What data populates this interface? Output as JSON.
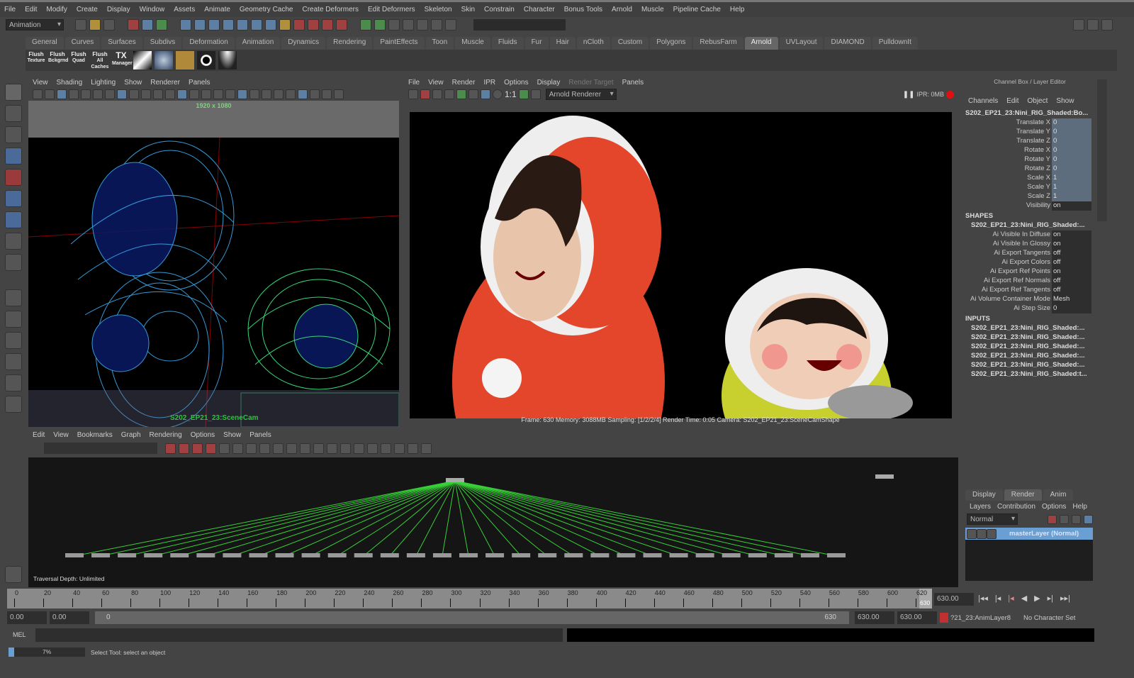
{
  "menubar": [
    "File",
    "Edit",
    "Modify",
    "Create",
    "Display",
    "Window",
    "Assets",
    "Animate",
    "Geometry Cache",
    "Create Deformers",
    "Edit Deformers",
    "Skeleton",
    "Skin",
    "Constrain",
    "Character",
    "Bonus Tools",
    "Arnold",
    "Muscle",
    "Pipeline Cache",
    "Help"
  ],
  "statusline": {
    "menuset": "Animation",
    "search_value": ""
  },
  "shelf_tabs": [
    "General",
    "Curves",
    "Surfaces",
    "Subdivs",
    "Deformation",
    "Animation",
    "Dynamics",
    "Rendering",
    "PaintEffects",
    "Toon",
    "Muscle",
    "Fluids",
    "Fur",
    "Hair",
    "nCloth",
    "Custom",
    "Polygons",
    "RebusFarm",
    "Arnold",
    "UVLayout",
    "DIAMOND",
    "PulldownIt"
  ],
  "active_shelf_tab": "Arnold",
  "shelf_buttons": [
    {
      "l1": "Flush",
      "l2": "Texture"
    },
    {
      "l1": "Flush",
      "l2": "Bckgrnd"
    },
    {
      "l1": "Flush",
      "l2": "Quad"
    },
    {
      "l1": "Flush",
      "l2": "All Caches"
    },
    {
      "l1": "TX",
      "l2": "Manager"
    }
  ],
  "viewport": {
    "menu": [
      "View",
      "Shading",
      "Lighting",
      "Show",
      "Renderer",
      "Panels"
    ],
    "resolution": "1920 x 1080",
    "camera": "S202_EP21_23:SceneCam"
  },
  "render_view": {
    "menu": [
      "File",
      "View",
      "Render",
      "IPR",
      "Options",
      "Display",
      "Render Target",
      "Panels"
    ],
    "ratio": "1:1",
    "renderer": "Arnold Renderer",
    "ipr": "IPR: 0MB",
    "status": "Frame: 630   Memory: 3088MB   Sampling: [1/2/2/4]   Render Time: 0:05   Camera: S202_EP21_23:SceneCamShape"
  },
  "channel_box": {
    "title": "Channel Box / Layer Editor",
    "menu": [
      "Channels",
      "Edit",
      "Object",
      "Show"
    ],
    "object": "S202_EP21_23:Nini_RIG_Shaded:Bo...",
    "channels": [
      {
        "name": "Translate X",
        "value": "0"
      },
      {
        "name": "Translate Y",
        "value": "0"
      },
      {
        "name": "Translate Z",
        "value": "0"
      },
      {
        "name": "Rotate X",
        "value": "0"
      },
      {
        "name": "Rotate Y",
        "value": "0"
      },
      {
        "name": "Rotate Z",
        "value": "0"
      },
      {
        "name": "Scale X",
        "value": "1"
      },
      {
        "name": "Scale Y",
        "value": "1"
      },
      {
        "name": "Scale Z",
        "value": "1"
      },
      {
        "name": "Visibility",
        "value": "on"
      }
    ],
    "shapes_header": "SHAPES",
    "shape_name": "S202_EP21_23:Nini_RIG_Shaded:...",
    "shape_attrs": [
      {
        "name": "Ai Visible In Diffuse",
        "value": "on"
      },
      {
        "name": "Ai Visible In Glossy",
        "value": "on"
      },
      {
        "name": "Ai Export Tangents",
        "value": "off"
      },
      {
        "name": "Ai Export Colors",
        "value": "off"
      },
      {
        "name": "Ai Export Ref Points",
        "value": "on"
      },
      {
        "name": "Ai Export Ref Normals",
        "value": "off"
      },
      {
        "name": "Ai Export Ref Tangents",
        "value": "off"
      },
      {
        "name": "Ai Volume Container Mode",
        "value": "Mesh"
      },
      {
        "name": "Ai Step Size",
        "value": "0"
      }
    ],
    "inputs_header": "INPUTS",
    "inputs": [
      "S202_EP21_23:Nini_RIG_Shaded:...",
      "S202_EP21_23:Nini_RIG_Shaded:...",
      "S202_EP21_23:Nini_RIG_Shaded:...",
      "S202_EP21_23:Nini_RIG_Shaded:...",
      "S202_EP21_23:Nini_RIG_Shaded:...",
      "S202_EP21_23:Nini_RIG_Shaded:t..."
    ]
  },
  "layer_editor": {
    "tabs": [
      "Display",
      "Render",
      "Anim"
    ],
    "active_tab": "Render",
    "menu": [
      "Layers",
      "Contribution",
      "Options",
      "Help"
    ],
    "blend_mode": "Normal",
    "layer": "masterLayer (Normal)"
  },
  "hypergraph": {
    "menu": [
      "Edit",
      "View",
      "Bookmarks",
      "Graph",
      "Rendering",
      "Options",
      "Show",
      "Panels"
    ],
    "traversal": "Traversal Depth: Unlimited"
  },
  "timeline": {
    "ticks": [
      "0",
      "20",
      "40",
      "60",
      "80",
      "100",
      "120",
      "140",
      "160",
      "180",
      "200",
      "220",
      "240",
      "260",
      "280",
      "300",
      "320",
      "340",
      "360",
      "380",
      "400",
      "420",
      "440",
      "460",
      "480",
      "500",
      "520",
      "540",
      "560",
      "580",
      "600",
      "620"
    ],
    "current_frame_marker": "630",
    "current_frame": "630.00"
  },
  "range": {
    "start": "0.00",
    "inner_start": "0.00",
    "slider_start": "0",
    "slider_end": "630",
    "inner_end": "630.00",
    "end": "630.00",
    "anim_layer": "?21_23:AnimLayer8",
    "character_set": "No Character Set"
  },
  "command": {
    "label": "MEL"
  },
  "helpline": {
    "progress": "7%",
    "progress_value": 0.07,
    "text": "Select Tool: select an object"
  },
  "colors": {
    "accent": "#6a9fd4",
    "wire_blue": "#3fb6ff",
    "wire_green": "#40ff90",
    "hyper_green": "#38d038",
    "jacket": "#e4462c"
  }
}
